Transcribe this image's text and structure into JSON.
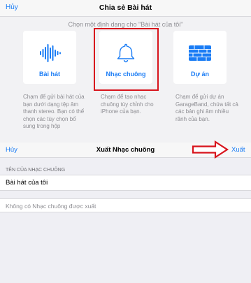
{
  "share_dialog": {
    "cancel_label": "Hủy",
    "title": "Chia sẻ Bài hát",
    "subtitle": "Chọn một định dạng cho \"Bài hát của tôi\"",
    "options": [
      {
        "label": "Bài hát",
        "icon": "waveform-icon",
        "description": "Chạm để gửi bài hát của bạn dưới dạng tệp âm thanh stereo. Bạn có thể chọn các tùy chọn bổ sung trong hộp"
      },
      {
        "label": "Nhạc chuông",
        "icon": "bell-icon",
        "description": "Chạm để tạo nhạc chuông tùy chỉnh cho iPhone của bạn."
      },
      {
        "label": "Dự án",
        "icon": "garageband-project-icon",
        "description": "Chạm để gửi dự án GarageBand, chứa tất cả các bản ghi âm nhiều rãnh của bạn."
      }
    ]
  },
  "export_panel": {
    "cancel_label": "Hủy",
    "title": "Xuất Nhạc chuông",
    "export_label": "Xuất",
    "section_header": "TÊN CỦA NHẠC CHUÔNG",
    "name_value": "Bài hát của tôi",
    "empty_message": "Không có Nhạc chuông được xuất"
  },
  "colors": {
    "accent": "#1a7cf5",
    "annotation": "#d8141c"
  }
}
